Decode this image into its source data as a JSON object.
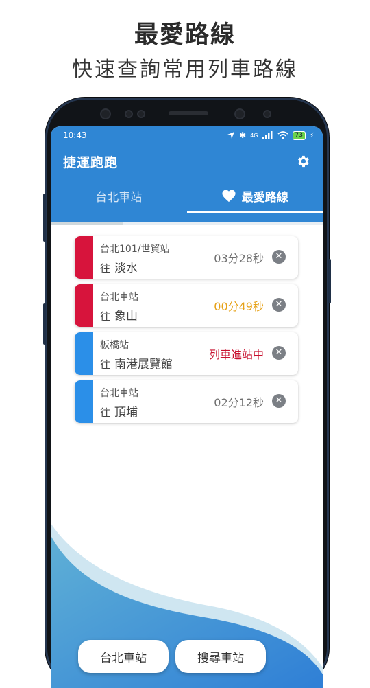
{
  "promo": {
    "title": "最愛路線",
    "subtitle": "快速查詢常用列車路線"
  },
  "status_bar": {
    "time": "10:43",
    "network": "4G",
    "battery": "73"
  },
  "app_bar": {
    "title": "捷運跑跑",
    "settings_icon": "gear-icon"
  },
  "tabs": [
    {
      "label": "台北車站",
      "active": false
    },
    {
      "label": "最愛路線",
      "active": true,
      "icon": "heart-icon"
    }
  ],
  "favorites": [
    {
      "station": "台北101/世貿站",
      "dest_prefix": "往",
      "destination": "淡水",
      "eta": "03分28秒",
      "line_color": "#d7143c",
      "eta_color": "#6f6f6f"
    },
    {
      "station": "台北車站",
      "dest_prefix": "往",
      "destination": "象山",
      "eta": "00分49秒",
      "line_color": "#d7143c",
      "eta_color": "#e6a117"
    },
    {
      "station": "板橋站",
      "dest_prefix": "往",
      "destination": "南港展覽館",
      "eta": "列車進站中",
      "line_color": "#2b8fe8",
      "eta_color": "#c8102e"
    },
    {
      "station": "台北車站",
      "dest_prefix": "往",
      "destination": "頂埔",
      "eta": "02分12秒",
      "line_color": "#2b8fe8",
      "eta_color": "#6f6f6f"
    }
  ],
  "bottom_buttons": {
    "left": "台北車站",
    "right": "搜尋車站"
  },
  "colors": {
    "primary": "#2f86d4",
    "red_line": "#d7143c",
    "blue_line": "#2b8fe8",
    "eta_warning": "#e6a117",
    "eta_arriving": "#c8102e"
  }
}
